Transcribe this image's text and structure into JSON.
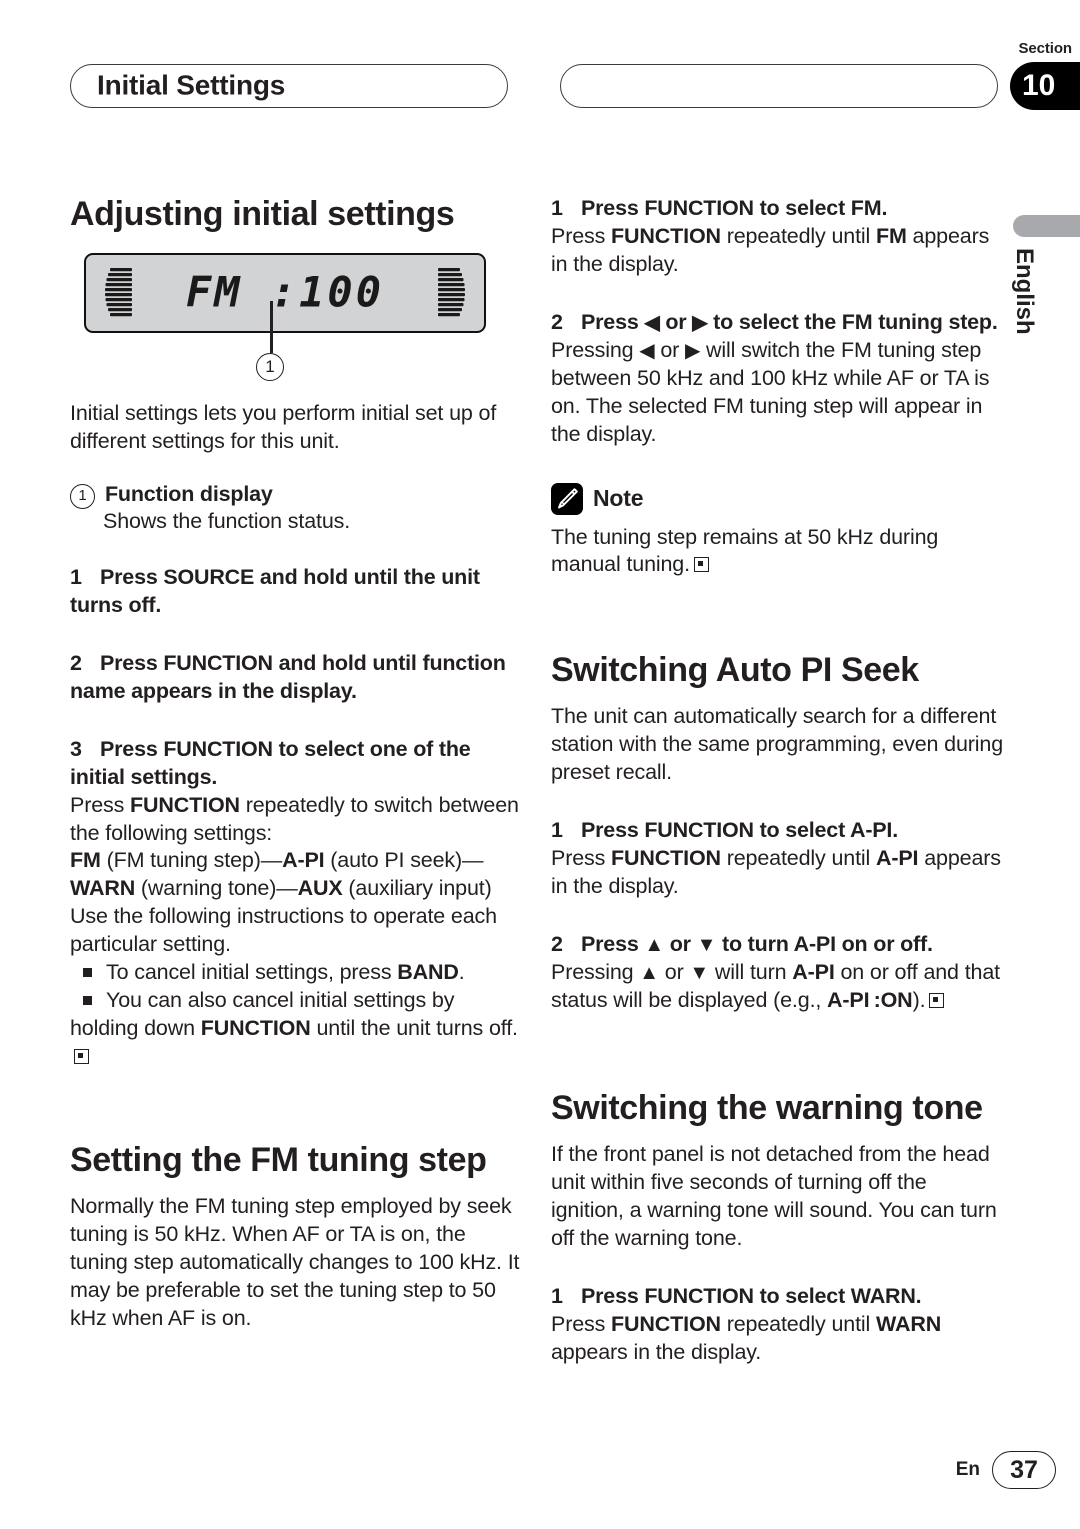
{
  "header": {
    "chapter_title": "Initial Settings",
    "section_label": "Section",
    "section_number": "10",
    "language_tab": "English"
  },
  "figure": {
    "lcd_text": "FM  :100",
    "callout_number": "1",
    "callout_label": "Function display",
    "callout_desc": "Shows the function status."
  },
  "left_column": {
    "heading": "Adjusting initial settings",
    "intro": "Initial settings lets you perform initial set up of different settings for this unit.",
    "steps": [
      {
        "num": "1",
        "title": "Press SOURCE and hold until the unit turns off."
      },
      {
        "num": "2",
        "title": "Press FUNCTION and hold until function name appears in the display."
      },
      {
        "num": "3",
        "title": "Press FUNCTION to select one of the initial settings."
      }
    ],
    "step3_body_1": "Press FUNCTION repeatedly to switch between the following settings:",
    "step3_body_2": "FM (FM tuning step)—A-PI (auto PI seek)—WARN (warning tone)—AUX (auxiliary input)",
    "step3_body_3": "Use the following instructions to operate each particular setting.",
    "bullets": [
      "To cancel initial settings, press BAND.",
      "You can also cancel initial settings by holding down FUNCTION until the unit turns off."
    ],
    "subheading_fm": "Setting the FM tuning step",
    "fm_intro": "Normally the FM tuning step employed by seek tuning is 50 kHz. When AF or TA is on, the tuning step automatically changes to 100 kHz. It may be preferable to set the tuning step to 50 kHz when AF is on."
  },
  "right_column": {
    "fm_steps": [
      {
        "num": "1",
        "title": "Press FUNCTION to select FM.",
        "body": "Press FUNCTION repeatedly until FM appears in the display."
      },
      {
        "num": "2",
        "title": "Press ◀ or ▶ to select the FM tuning step.",
        "body": "Pressing ◀ or ▶ will switch the FM tuning step between 50 kHz and 100 kHz while AF or TA is on. The selected FM tuning step will appear in the display."
      }
    ],
    "note_label": "Note",
    "note_text": "The tuning step remains at 50 kHz during manual tuning.",
    "heading_api": "Switching Auto PI Seek",
    "api_intro": "The unit can automatically search for a different station with the same programming, even during preset recall.",
    "api_steps": [
      {
        "num": "1",
        "title": "Press FUNCTION to select A-PI.",
        "body": "Press FUNCTION repeatedly until A-PI appears in the display."
      },
      {
        "num": "2",
        "title": "Press ▲ or ▼ to turn A-PI on or off.",
        "body": "Pressing ▲ or ▼ will turn A-PI on or off and that status will be displayed (e.g., A-PI :ON)."
      }
    ],
    "heading_warn": "Switching the warning tone",
    "warn_intro": "If the front panel is not detached from the head unit within five seconds of turning off the ignition, a warning tone will sound. You can turn off the warning tone.",
    "warn_steps": [
      {
        "num": "1",
        "title": "Press FUNCTION to select WARN.",
        "body": "Press FUNCTION repeatedly until WARN appears in the display."
      }
    ]
  },
  "footer": {
    "language_code": "En",
    "page_number": "37"
  },
  "colors": {
    "text": "#231f20",
    "lcd_background": "#d2d3d5",
    "tab_gray": "#a7a9ac",
    "badge_black": "#000000"
  }
}
